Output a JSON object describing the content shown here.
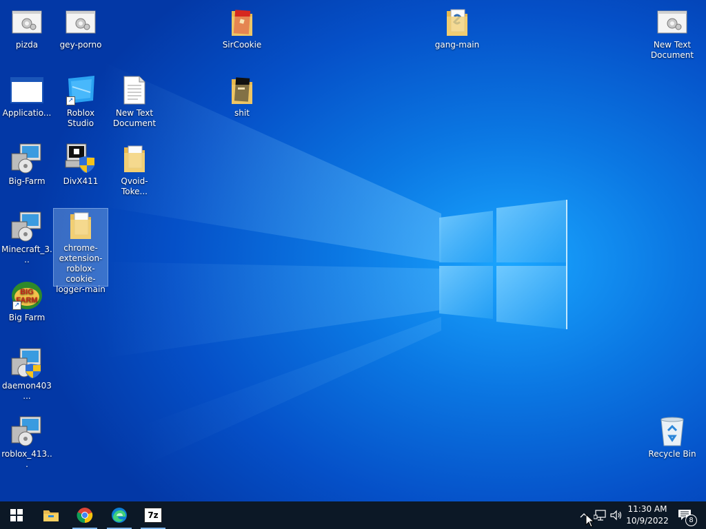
{
  "desktop_icons": [
    {
      "label": "pizda",
      "icon": "dll-settings-icon"
    },
    {
      "label": "gey-porno",
      "icon": "dll-settings-icon"
    },
    {
      "label": "SirCookie",
      "icon": "folder-icon"
    },
    {
      "label": "gang-main",
      "icon": "folder-icon"
    },
    {
      "label": "New Text Document",
      "icon": "dll-settings-icon"
    },
    {
      "label": "Applicatio...",
      "icon": "application-window-icon"
    },
    {
      "label": "Roblox Studio",
      "icon": "roblox-studio-icon"
    },
    {
      "label": "New Text Document",
      "icon": "text-document-icon"
    },
    {
      "label": "shit",
      "icon": "folder-icon"
    },
    {
      "label": "Big-Farm",
      "icon": "installer-icon"
    },
    {
      "label": "DivX411",
      "icon": "installer-shield-icon"
    },
    {
      "label": "Qvoid-Toke...",
      "icon": "folder-icon"
    },
    {
      "label": "Minecraft_3...",
      "icon": "installer-icon"
    },
    {
      "label": "chrome-extension-roblox-cookie-logger-main",
      "icon": "folder-icon"
    },
    {
      "label": "Big Farm",
      "icon": "big-farm-icon"
    },
    {
      "label": "daemon403...",
      "icon": "installer-shield-icon"
    },
    {
      "label": "roblox_413...",
      "icon": "installer-icon"
    },
    {
      "label": "Recycle Bin",
      "icon": "recycle-bin-icon"
    }
  ],
  "taskbar": {
    "items": [
      {
        "name": "Start",
        "icon": "windows-logo-icon"
      },
      {
        "name": "File Explorer",
        "icon": "file-explorer-icon"
      },
      {
        "name": "Google Chrome",
        "icon": "chrome-icon"
      },
      {
        "name": "Microsoft Edge",
        "icon": "edge-icon"
      },
      {
        "name": "7-Zip",
        "icon": "7zip-icon"
      }
    ],
    "zip_label": "7z",
    "tray": {
      "time": "11:30 AM",
      "date": "10/9/2022",
      "notification_count": "8"
    }
  },
  "colors": {
    "desktop_blue": "#0b78e3",
    "taskbar": "#0c1826",
    "folder": "#f3d27a"
  }
}
